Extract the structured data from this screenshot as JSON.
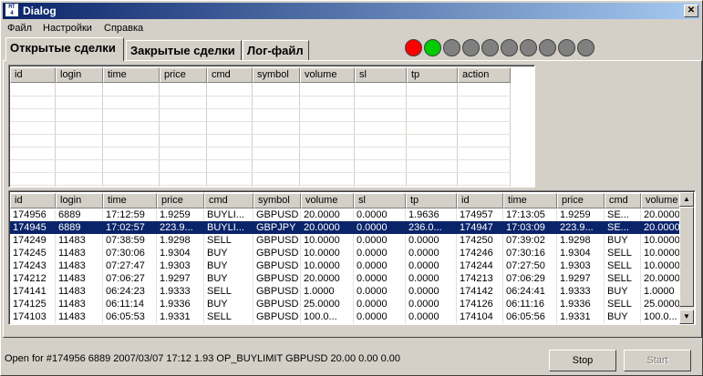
{
  "window": {
    "title": "Dialog",
    "close_glyph": "✕"
  },
  "menu": [
    "Файл",
    "Настройки",
    "Справка"
  ],
  "tabs": [
    "Открытые сделки",
    "Закрытые сделки",
    "Лог-файл"
  ],
  "leds": [
    "#ff0000",
    "#00cc00",
    "#808080",
    "#808080",
    "#808080",
    "#808080",
    "#808080",
    "#808080",
    "#808080",
    "#808080"
  ],
  "open_columns": [
    "id",
    "login",
    "time",
    "price",
    "cmd",
    "symbol",
    "volume",
    "sl",
    "tp",
    "action"
  ],
  "closed_columns": [
    "id",
    "login",
    "time",
    "price",
    "cmd",
    "symbol",
    "volume",
    "sl",
    "tp",
    "id",
    "time",
    "price",
    "cmd",
    "volume"
  ],
  "closed_rows": [
    [
      "174956",
      "6889",
      "17:12:59",
      "1.9259",
      "BUYLI...",
      "GBPUSD",
      "20.0000",
      "0.0000",
      "1.9636",
      "174957",
      "17:13:05",
      "1.9259",
      "SE...",
      "20.0000"
    ],
    [
      "174945",
      "6889",
      "17:02:57",
      "223.9...",
      "BUYLI...",
      "GBPJPY",
      "20.0000",
      "0.0000",
      "236.0...",
      "174947",
      "17:03:09",
      "223.9...",
      "SE...",
      "20.0000"
    ],
    [
      "174249",
      "11483",
      "07:38:59",
      "1.9298",
      "SELL",
      "GBPUSD",
      "10.0000",
      "0.0000",
      "0.0000",
      "174250",
      "07:39:02",
      "1.9298",
      "BUY",
      "10.0000"
    ],
    [
      "174245",
      "11483",
      "07:30:06",
      "1.9304",
      "BUY",
      "GBPUSD",
      "10.0000",
      "0.0000",
      "0.0000",
      "174246",
      "07:30:16",
      "1.9304",
      "SELL",
      "10.0000"
    ],
    [
      "174243",
      "11483",
      "07:27:47",
      "1.9303",
      "BUY",
      "GBPUSD",
      "10.0000",
      "0.0000",
      "0.0000",
      "174244",
      "07:27:50",
      "1.9303",
      "SELL",
      "10.0000"
    ],
    [
      "174212",
      "11483",
      "07:06:27",
      "1.9297",
      "BUY",
      "GBPUSD",
      "20.0000",
      "0.0000",
      "0.0000",
      "174213",
      "07:06:29",
      "1.9297",
      "SELL",
      "20.0000"
    ],
    [
      "174141",
      "11483",
      "06:24:23",
      "1.9333",
      "SELL",
      "GBPUSD",
      "1.0000",
      "0.0000",
      "0.0000",
      "174142",
      "06:24:41",
      "1.9333",
      "BUY",
      "1.0000"
    ],
    [
      "174125",
      "11483",
      "06:11:14",
      "1.9336",
      "BUY",
      "GBPUSD",
      "25.0000",
      "0.0000",
      "0.0000",
      "174126",
      "06:11:16",
      "1.9336",
      "SELL",
      "25.0000"
    ],
    [
      "174103",
      "11483",
      "06:05:53",
      "1.9331",
      "SELL",
      "GBPUSD",
      "100.0...",
      "0.0000",
      "0.0000",
      "174104",
      "06:05:56",
      "1.9331",
      "BUY",
      "100.0..."
    ]
  ],
  "selected_row_index": 1,
  "status_text": "Open for #174956 6889 2007/03/07 17:12 1.93 OP_BUYLIMIT GBPUSD 20.00 0.00 0.00",
  "buttons": {
    "stop": "Stop",
    "start": "Start"
  },
  "scroll_glyphs": {
    "up": "▲",
    "down": "▼"
  },
  "colors": {
    "titlebar_start": "#0a246a",
    "titlebar_end": "#a6caf0",
    "selection": "#0a246a"
  }
}
